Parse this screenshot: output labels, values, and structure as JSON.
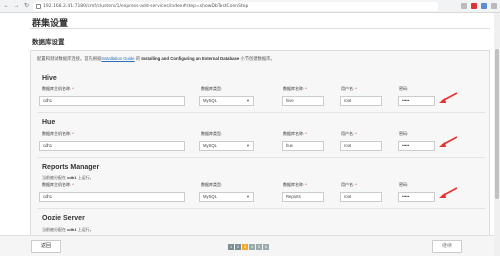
{
  "browser": {
    "url": "192.168.2.41:7180/cmf/clusters/1/express-add-services/index#step=showDbTestConnStep"
  },
  "page": {
    "title": "群集设置",
    "section_title": "数据库设置"
  },
  "intro": {
    "prefix": "配置和测试数据库连接。首先根据",
    "link": "Installation Guide",
    "middle": " 的 ",
    "bold": "Installing and Configuring an External Database",
    "suffix": " 小节创建数据库。"
  },
  "labels": {
    "host": "数据库主机名称:",
    "type": "数据库类型:",
    "dbname": "数据库名称:",
    "user": "用户名:",
    "password": "密码:",
    "required_mark": "*"
  },
  "services": [
    {
      "name": "Hive",
      "note": "",
      "host": "cdh1",
      "type": "MySQL",
      "dbname": "hive",
      "user": "root",
      "password": "•••••"
    },
    {
      "name": "Hue",
      "note": "",
      "host": "cdh1",
      "type": "MySQL",
      "dbname": "hue",
      "user": "root",
      "password": "•••••"
    },
    {
      "name": "Reports Manager",
      "note_prefix": "当前被分配在 ",
      "note_host": "cdh1",
      "note_suffix": " 上运行。",
      "host": "cdh1",
      "type": "MySQL",
      "dbname": "Reports",
      "user": "root",
      "password": "•••••"
    },
    {
      "name": "Oozie Server",
      "note_prefix": "当前被分配在 ",
      "note_host": "cdh1",
      "note_suffix": " 上运行。"
    }
  ],
  "footer": {
    "back": "返回",
    "next": "继续",
    "steps": [
      "1",
      "2",
      "3",
      "4",
      "5",
      "6"
    ]
  },
  "colors": {
    "accent_arrow": "#e8312f",
    "active_step": "#f0a92b",
    "link": "#2a6fb5"
  }
}
